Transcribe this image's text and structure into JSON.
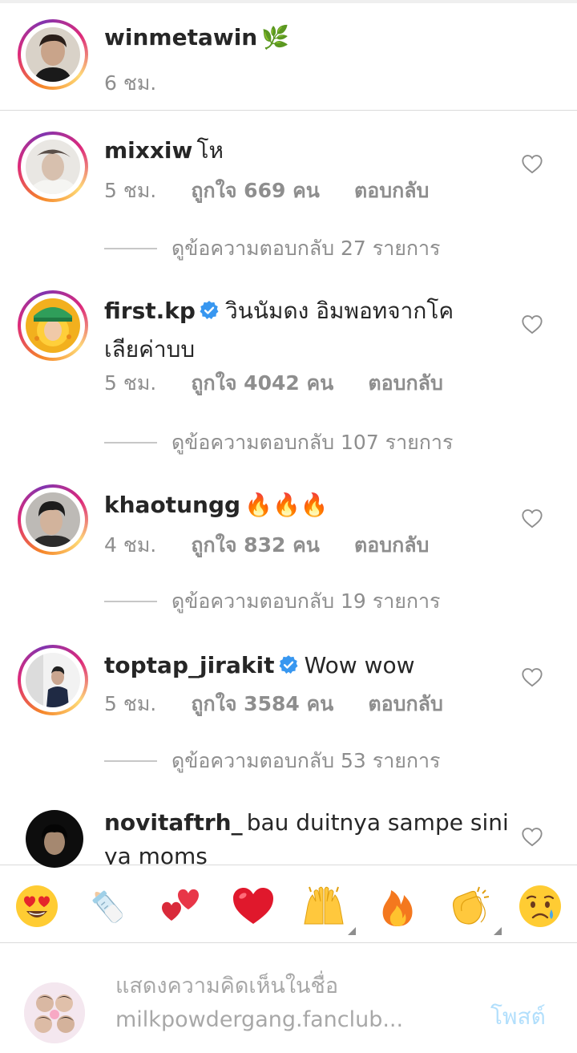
{
  "caption": {
    "username": "winmetawin",
    "emoji": "🌿",
    "time": "6 ชม."
  },
  "comments": [
    {
      "username": "mixxiw",
      "verified": false,
      "text": "โห",
      "time": "5 ชม.",
      "likes": "ถูกใจ 669 คน",
      "reply": "ตอบกลับ",
      "view_replies": "ดูข้อความตอบกลับ 27 รายการ"
    },
    {
      "username": "first.kp",
      "verified": true,
      "text": "วินนัมดง อิมพอทจากโคเลียค่าบบ",
      "line1": "วินนัมดง อิมพอทจากโค",
      "line2": "เลียค่าบบ",
      "time": "5 ชม.",
      "likes": "ถูกใจ 4042 คน",
      "reply": "ตอบกลับ",
      "view_replies": "ดูข้อความตอบกลับ 107 รายการ"
    },
    {
      "username": "khaotungg",
      "verified": false,
      "text": "🔥🔥🔥",
      "time": "4 ชม.",
      "likes": "ถูกใจ 832 คน",
      "reply": "ตอบกลับ",
      "view_replies": "ดูข้อความตอบกลับ 19 รายการ"
    },
    {
      "username": "toptap_jirakit",
      "verified": true,
      "text": "Wow wow",
      "time": "5 ชม.",
      "likes": "ถูกใจ 3584 คน",
      "reply": "ตอบกลับ",
      "view_replies": "ดูข้อความตอบกลับ 53 รายการ"
    },
    {
      "username": "novitaftrh_",
      "verified": false,
      "text": "bau duitnya sampe sini ya moms",
      "line1": "bau duitnya sampe sini",
      "line2": "ya moms"
    }
  ],
  "emoji_bar": [
    {
      "glyph": "😍",
      "icon": "heart-eyes-emoji"
    },
    {
      "glyph": "🍼",
      "icon": "baby-bottle-emoji"
    },
    {
      "glyph": "💕",
      "icon": "two-hearts-emoji"
    },
    {
      "glyph": "❤️",
      "icon": "red-heart-emoji"
    },
    {
      "glyph": "🙌",
      "icon": "raising-hands-emoji"
    },
    {
      "glyph": "🔥",
      "icon": "fire-emoji"
    },
    {
      "glyph": "👏",
      "icon": "clapping-hands-emoji"
    },
    {
      "glyph": "😥",
      "icon": "sad-relieved-emoji"
    }
  ],
  "composer": {
    "placeholder_line1": "แสดงความคิดเห็นในชื่อ",
    "placeholder_line2": "milkpowdergang.fanclub...",
    "post_label": "โพสต์"
  },
  "colors": {
    "text": "#262626",
    "secondary": "#8e8e8e",
    "verified": "#3897f0",
    "post_disabled": "#b2dffc",
    "divider": "#dbdbdb"
  }
}
